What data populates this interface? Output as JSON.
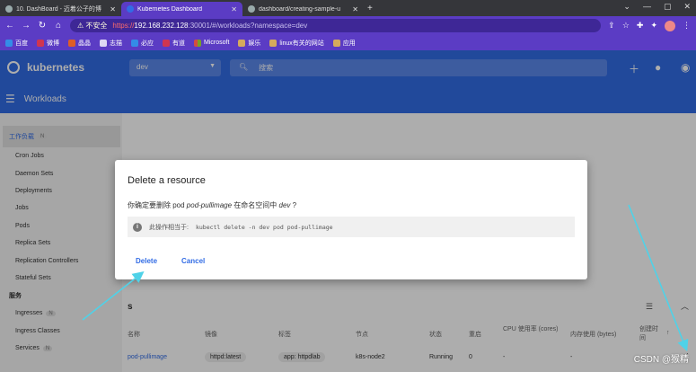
{
  "browser": {
    "tabs": [
      {
        "title": "10. DashBoard - 迈着公子的博",
        "active": false
      },
      {
        "title": "Kubernetes Dashboard",
        "active": true
      },
      {
        "title": "dashboard/creating-sample-u",
        "active": false
      }
    ],
    "new_tab": "+",
    "security_label": "不安全",
    "url_scheme": "https://",
    "url_host": "192.168.232.128",
    "url_rest": ":30001/#/workloads?namespace=dev",
    "bookmarks": [
      "百度",
      "微博",
      "晶晶",
      "志描",
      "必应",
      "有道",
      "Microsoft",
      "娱乐",
      "linux有关的网站",
      "应用"
    ]
  },
  "k8s": {
    "brand": "kubernetes",
    "namespace": "dev",
    "search_placeholder": "搜索",
    "section_title": "Workloads"
  },
  "sidebar": {
    "group_label": "工作负载",
    "group_badge": "N",
    "items": [
      "Cron Jobs",
      "Daemon Sets",
      "Deployments",
      "Jobs",
      "Pods",
      "Replica Sets",
      "Replication Controllers",
      "Stateful Sets"
    ],
    "section2": "服务",
    "items2": [
      {
        "label": "Ingresses",
        "badge": "N"
      },
      {
        "label": "Ingress Classes",
        "badge": ""
      },
      {
        "label": "Services",
        "badge": "N"
      }
    ]
  },
  "table": {
    "title": "s",
    "headers": [
      "名称",
      "镜像",
      "标签",
      "节点",
      "状态",
      "重启",
      "CPU 使用率 (cores)",
      "内存使用 (bytes)",
      "创建时间"
    ],
    "row": {
      "name": "pod-pullimage",
      "image": "httpd:latest",
      "label": "app: httpdlab",
      "node": "k8s-node2",
      "status": "Running",
      "restarts": "0",
      "cpu": "-",
      "mem": "-"
    }
  },
  "dialog": {
    "title": "Delete a resource",
    "message_prefix": "你确定要删除 pod ",
    "message_name": "pod-pullimage",
    "message_mid": " 在命名空间中 ",
    "message_ns": "dev",
    "message_suffix": " ?",
    "info_prefix": "此操作相当于:",
    "info_cmd": "kubectl delete -n dev pod pod-pullimage",
    "delete_label": "Delete",
    "cancel_label": "Cancel"
  },
  "watermark": "CSDN @猴精",
  "colors": {
    "k8s_blue": "#326ce5",
    "browser_purple": "#5b3cc4",
    "arrow": "#4fd2e8"
  }
}
